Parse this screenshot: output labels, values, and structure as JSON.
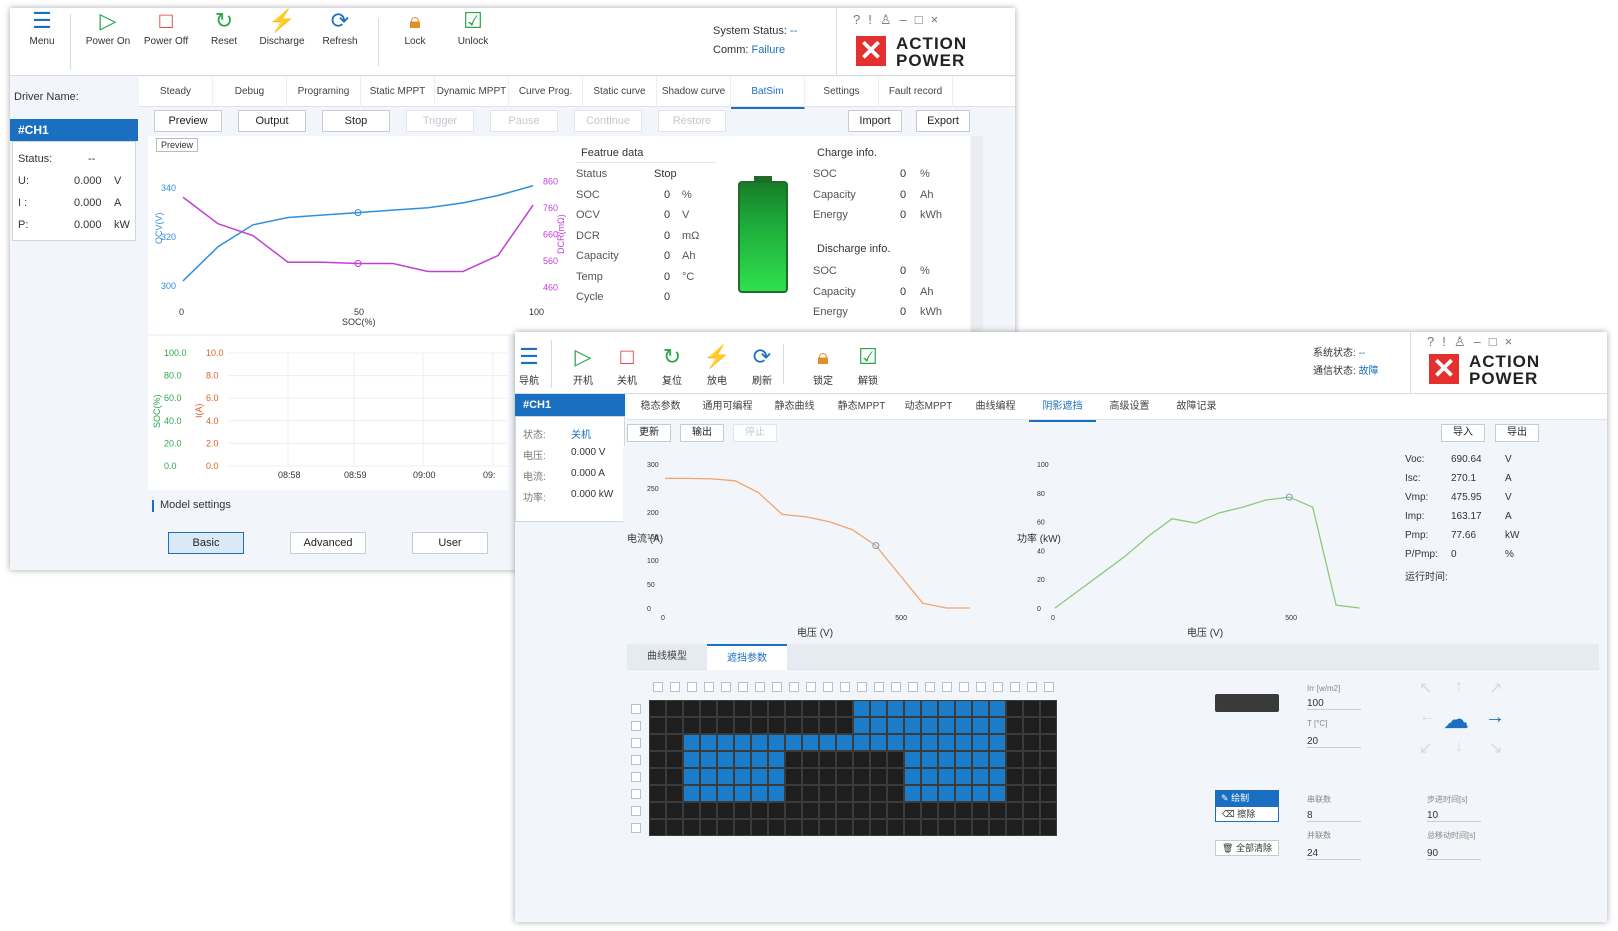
{
  "w1": {
    "toolbar": [
      {
        "icon": "menu-icon",
        "label": "Menu",
        "color": "#1b6fc1"
      },
      {
        "icon": "power-on-icon",
        "label": "Power On",
        "color": "#2aa84a"
      },
      {
        "icon": "power-off-icon",
        "label": "Power Off",
        "color": "#e53030"
      },
      {
        "icon": "reset-icon",
        "label": "Reset",
        "color": "#2aa84a"
      },
      {
        "icon": "discharge-icon",
        "label": "Discharge",
        "color": "#1b6fc1"
      },
      {
        "icon": "refresh-icon",
        "label": "Refresh",
        "color": "#1b6fc1"
      },
      {
        "icon": "lock-icon",
        "label": "Lock",
        "color": "#e0902a"
      },
      {
        "icon": "unlock-icon",
        "label": "Unlock",
        "color": "#2aa84a"
      }
    ],
    "status": {
      "sys_label": "System Status:",
      "sys_value": "--",
      "comm_label": "Comm:",
      "comm_value": "Failure"
    },
    "logo": {
      "l1": "ACTION",
      "l2": "POWER"
    },
    "driver_label": "Driver Name:",
    "tabs": [
      "Steady",
      "Debug",
      "Programing",
      "Static MPPT",
      "Dynamic MPPT",
      "Curve Prog.",
      "Static curve",
      "Shadow curve",
      "BatSim",
      "Settings",
      "Fault record"
    ],
    "active_tab": "BatSim",
    "channel": "#CH1",
    "ch_info": [
      {
        "label": "Status:",
        "value": "--",
        "unit": ""
      },
      {
        "label": "U:",
        "value": "0.000",
        "unit": "V"
      },
      {
        "label": "I :",
        "value": "0.000",
        "unit": "A"
      },
      {
        "label": "P:",
        "value": "0.000",
        "unit": "kW"
      }
    ],
    "buttons": [
      {
        "label": "Preview",
        "enabled": true
      },
      {
        "label": "Output",
        "enabled": true
      },
      {
        "label": "Stop",
        "enabled": true
      },
      {
        "label": "Trigger",
        "enabled": false
      },
      {
        "label": "Pause",
        "enabled": false
      },
      {
        "label": "Continue",
        "enabled": false
      },
      {
        "label": "Restore",
        "enabled": false
      },
      {
        "label": "Import",
        "enabled": true
      },
      {
        "label": "Export",
        "enabled": true
      }
    ],
    "preview_tag": "Preview",
    "feature": {
      "title": "Featrue data",
      "rows": [
        {
          "label": "Status",
          "value": "Stop",
          "unit": ""
        },
        {
          "label": "SOC",
          "value": "0",
          "unit": "%"
        },
        {
          "label": "OCV",
          "value": "0",
          "unit": "V"
        },
        {
          "label": "DCR",
          "value": "0",
          "unit": "mΩ"
        },
        {
          "label": "Capacity",
          "value": "0",
          "unit": "Ah"
        },
        {
          "label": "Temp",
          "value": "0",
          "unit": "°C"
        },
        {
          "label": "Cycle",
          "value": "0",
          "unit": ""
        }
      ]
    },
    "charge": {
      "title": "Charge info.",
      "rows": [
        {
          "label": "SOC",
          "value": "0",
          "unit": "%"
        },
        {
          "label": "Capacity",
          "value": "0",
          "unit": "Ah"
        },
        {
          "label": "Energy",
          "value": "0",
          "unit": "kWh"
        }
      ]
    },
    "discharge": {
      "title": "Discharge info.",
      "rows": [
        {
          "label": "SOC",
          "value": "0",
          "unit": "%"
        },
        {
          "label": "Capacity",
          "value": "0",
          "unit": "Ah"
        },
        {
          "label": "Energy",
          "value": "0",
          "unit": "kWh"
        }
      ]
    },
    "model": {
      "title": "Model settings",
      "buttons": [
        "Basic",
        "Advanced",
        "User"
      ],
      "active": "Basic"
    }
  },
  "chart_data": [
    {
      "type": "line",
      "x": [
        0,
        10,
        20,
        30,
        40,
        50,
        60,
        70,
        80,
        90,
        100
      ],
      "xlabel": "SOC(%)",
      "ylabel": "OCV(V)",
      "y2label": "DCR(mΩ)",
      "xticks": [
        "0",
        "50",
        "100"
      ],
      "yticks": [
        "300",
        "320",
        "340"
      ],
      "y2ticks": [
        "460",
        "560",
        "660",
        "760",
        "860"
      ],
      "ylim": [
        295,
        345
      ],
      "y2lim": [
        420,
        880
      ],
      "series": [
        {
          "axis": "left",
          "color": "#2f8ee0",
          "values": [
            302,
            316,
            325,
            328,
            329,
            330,
            331,
            332,
            334,
            337,
            341
          ]
        },
        {
          "axis": "right",
          "color": "#c23fd6",
          "values": [
            800,
            700,
            655,
            555,
            555,
            550,
            550,
            520,
            520,
            580,
            770
          ]
        }
      ]
    },
    {
      "type": "line",
      "yticks": [
        "100.0",
        "80.0",
        "60.0",
        "40.0",
        "20.0",
        "0.0"
      ],
      "y2ticks": [
        "10.0",
        "8.0",
        "6.0",
        "4.0",
        "2.0",
        "0.0"
      ],
      "ylabel": "SOC(%)",
      "y2label": "I(A)",
      "xticks": [
        "08:58",
        "08:59",
        "09:00",
        "09:"
      ],
      "series": []
    },
    {
      "type": "line",
      "x": [
        0,
        50,
        100,
        150,
        200,
        250,
        300,
        350,
        400,
        450,
        500,
        550,
        600,
        650
      ],
      "xlabel": "电压 (V)",
      "ylabel": "电流 (A)",
      "ylim": [
        0,
        300
      ],
      "xticks": [
        "0",
        "500"
      ],
      "yticks": [
        "300",
        "250",
        "200",
        "150",
        "100",
        "50",
        "0"
      ],
      "series": [
        {
          "color": "#f2a56b",
          "values": [
            270,
            270,
            269,
            265,
            240,
            195,
            190,
            180,
            163,
            130,
            70,
            10,
            0,
            0
          ]
        }
      ]
    },
    {
      "type": "line",
      "x": [
        0,
        50,
        100,
        150,
        200,
        250,
        300,
        350,
        400,
        450,
        500,
        550,
        600,
        650
      ],
      "xlabel": "电压 (V)",
      "ylabel": "功率 (kW)",
      "ylim": [
        0,
        100
      ],
      "xticks": [
        "0",
        "500"
      ],
      "yticks": [
        "100",
        "80",
        "60",
        "40",
        "20",
        "0"
      ],
      "series": [
        {
          "color": "#8cc97d",
          "values": [
            0,
            12,
            24,
            36,
            50,
            62,
            59,
            66,
            70,
            75,
            77,
            70,
            2,
            0
          ]
        }
      ]
    }
  ],
  "w2": {
    "toolbar": [
      {
        "icon": "menu-icon",
        "label": "导航",
        "color": "#1b6fc1"
      },
      {
        "icon": "power-on-icon",
        "label": "开机",
        "color": "#2aa84a"
      },
      {
        "icon": "power-off-icon",
        "label": "关机",
        "color": "#e53030"
      },
      {
        "icon": "reset-icon",
        "label": "复位",
        "color": "#2aa84a"
      },
      {
        "icon": "discharge-icon",
        "label": "放电",
        "color": "#1b6fc1"
      },
      {
        "icon": "refresh-icon",
        "label": "刷新",
        "color": "#1b6fc1"
      },
      {
        "icon": "lock-icon",
        "label": "锁定",
        "color": "#e0902a"
      },
      {
        "icon": "unlock-icon",
        "label": "解锁",
        "color": "#2aa84a"
      }
    ],
    "status": {
      "sys_label": "系统状态:",
      "sys_value": "--",
      "comm_label": "通信状态:",
      "comm_value": "故障"
    },
    "logo": {
      "l1": "ACTION",
      "l2": "POWER"
    },
    "channel": "#CH1",
    "ch_info": [
      {
        "label": "状态:",
        "value": "关机"
      },
      {
        "label": "电压:",
        "value": "0.000 V"
      },
      {
        "label": "电流:",
        "value": "0.000 A"
      },
      {
        "label": "功率:",
        "value": "0.000 kW"
      }
    ],
    "tabs": [
      "稳态参数",
      "通用可编程",
      "静态曲线",
      "静态MPPT",
      "动态MPPT",
      "曲线编程",
      "阴影遮挡",
      "高级设置",
      "故障记录"
    ],
    "active_tab": "阴影遮挡",
    "buttons": [
      {
        "label": "更新",
        "enabled": true
      },
      {
        "label": "输出",
        "enabled": true
      },
      {
        "label": "停止",
        "enabled": false
      },
      {
        "label": "导入",
        "enabled": true
      },
      {
        "label": "导出",
        "enabled": true
      }
    ],
    "results": [
      {
        "label": "Voc:",
        "value": "690.64",
        "unit": "V"
      },
      {
        "label": "Isc:",
        "value": "270.1",
        "unit": "A"
      },
      {
        "label": "Vmp:",
        "value": "475.95",
        "unit": "V"
      },
      {
        "label": "Imp:",
        "value": "163.17",
        "unit": "A"
      },
      {
        "label": "Pmp:",
        "value": "77.66",
        "unit": "kW"
      },
      {
        "label": "P/Pmp:",
        "value": "0",
        "unit": "%"
      },
      {
        "label": "运行时间:",
        "value": "",
        "unit": ""
      }
    ],
    "subtabs": [
      "曲线模型",
      "遮挡参数"
    ],
    "active_subtab": "遮挡参数",
    "shade": {
      "irr_label": "Irr [w/m2]",
      "irr": "100",
      "t_label": "T [°C]",
      "t": "20",
      "draw": "绘制",
      "erase": "擦除",
      "clear_all": "全部清除",
      "series_label": "串联数",
      "series": "8",
      "parallel_label": "并联数",
      "parallel": "24",
      "step_label": "步进时间[s]",
      "step": "10",
      "total_label": "总移动时间[s]",
      "total": "90",
      "grid": [
        "000000000000111111111000",
        "000000000000111111111000",
        "001111111111111111111000",
        "001111110000000111111000",
        "001111110000000111111000",
        "001111110000000111111000",
        "000000000000000000000000",
        "000000000000000000000000"
      ]
    }
  }
}
